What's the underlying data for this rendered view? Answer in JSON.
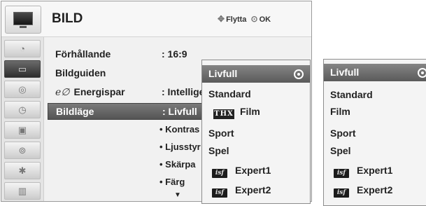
{
  "menu": {
    "title": "BILD",
    "hint_move_icon": "dpad-icon",
    "hint_move": "Flytta",
    "hint_ok_icon": "ok-button-icon",
    "hint_ok": "OK",
    "categories": [
      "satellite-dish-icon",
      "tv-picture-icon",
      "speaker-icon",
      "clock-icon",
      "lock-icon",
      "input-icon",
      "bluetooth-icon",
      "usb-media-icon"
    ],
    "active_category": 1,
    "rows": [
      {
        "label": "Förhållande",
        "value": ": 16:9"
      },
      {
        "label": "Bildguiden",
        "value": ""
      },
      {
        "label_prefix": "e∅",
        "label": "Energispar",
        "value": ": Intellige"
      },
      {
        "label": "Bildläge",
        "value": ": Livfull",
        "selected": true
      }
    ],
    "sub_items": [
      "• Kontras",
      "• Ljusstyr",
      "• Skärpa",
      "• Färg"
    ]
  },
  "picture_mode_dropdown": {
    "options": [
      {
        "label": "Livfull",
        "selected": true
      },
      {
        "label": "Standard"
      },
      {
        "label": "Film",
        "badge": "THX"
      },
      {
        "label": "Sport"
      },
      {
        "label": "Spel"
      },
      {
        "label": "Expert1",
        "badge": "isf"
      },
      {
        "label": "Expert2",
        "badge": "isf"
      }
    ]
  },
  "picture_mode_dropdown_alt": {
    "options": [
      {
        "label": "Livfull",
        "selected": true
      },
      {
        "label": "Standard"
      },
      {
        "label": "Film"
      },
      {
        "label": "Sport"
      },
      {
        "label": "Spel"
      },
      {
        "label": "Expert1",
        "badge": "isf"
      },
      {
        "label": "Expert2",
        "badge": "isf"
      }
    ]
  }
}
